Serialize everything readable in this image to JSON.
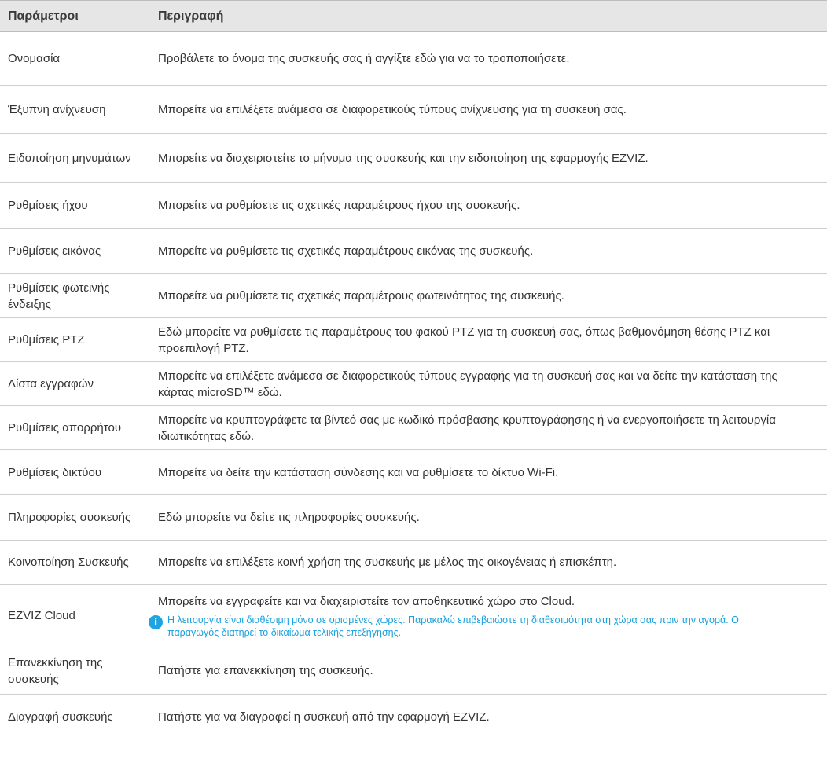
{
  "table": {
    "headers": [
      "Παράμετροι",
      "Περιγραφή"
    ],
    "rows": [
      {
        "param": "Ονομασία",
        "desc": "Προβάλετε το όνομα της συσκευής σας ή αγγίξτε εδώ για να το τροποποιήσετε."
      },
      {
        "param": "Έξυπνη ανίχνευση",
        "desc": "Μπορείτε να επιλέξετε ανάμεσα σε διαφορετικούς τύπους ανίχνευσης για τη συσκευή σας."
      },
      {
        "param": "Ειδοποίηση μηνυμάτων",
        "desc": "Μπορείτε να διαχειριστείτε το μήνυμα της συσκευής και την ειδοποίηση της εφαρμογής EZVIZ."
      },
      {
        "param": "Ρυθμίσεις ήχου",
        "desc": "Μπορείτε να ρυθμίσετε τις σχετικές παραμέτρους ήχου της συσκευής."
      },
      {
        "param": "Ρυθμίσεις εικόνας",
        "desc": "Μπορείτε να ρυθμίσετε τις σχετικές παραμέτρους εικόνας της συσκευής."
      },
      {
        "param": "Ρυθμίσεις φωτεινής ένδειξης",
        "desc": "Μπορείτε να ρυθμίσετε τις σχετικές παραμέτρους φωτεινότητας της συσκευής."
      },
      {
        "param": "Ρυθμίσεις PTZ",
        "desc": "Εδώ μπορείτε να ρυθμίσετε τις παραμέτρους του φακού PTZ για τη συσκευή σας, όπως βαθμονόμηση θέσης PTZ και προεπιλογή PTZ."
      },
      {
        "param": "Λίστα εγγραφών",
        "desc": "Μπορείτε να επιλέξετε ανάμεσα σε διαφορετικούς τύπους εγγραφής για τη συσκευή σας και να δείτε την κατάσταση της κάρτας microSD™ εδώ."
      },
      {
        "param": "Ρυθμίσεις απορρήτου",
        "desc": "Μπορείτε να κρυπτογράφετε τα βίντεό σας με κωδικό πρόσβασης κρυπτογράφησης ή να ενεργοποιήσετε τη λειτουργία ιδιωτικότητας εδώ."
      },
      {
        "param": "Ρυθμίσεις δικτύου",
        "desc": "Μπορείτε να δείτε την κατάσταση σύνδεσης και να ρυθμίσετε το δίκτυο Wi-Fi."
      },
      {
        "param": "Πληροφορίες συσκευής",
        "desc": "Εδώ μπορείτε να δείτε τις πληροφορίες συσκευής."
      },
      {
        "param": "Κοινοποίηση Συσκευής",
        "desc": "Μπορείτε να επιλέξετε κοινή χρήση της συσκευής με μέλος της οικογένειας ή επισκέπτη."
      },
      {
        "param": "EZVIZ Cloud",
        "desc": "Μπορείτε να εγγραφείτε και να διαχειριστείτε τον αποθηκευτικό χώρο στο Cloud.",
        "note": "Η λειτουργία είναι διαθέσιμη μόνο σε ορισμένες χώρες. Παρακαλώ επιβεβαιώστε τη διαθεσιμότητα στη χώρα σας πριν την αγορά. Ο παραγωγός διατηρεί το δικαίωμα τελικής επεξήγησης."
      },
      {
        "param": "Επανεκκίνηση της συσκευής",
        "desc": "Πατήστε για επανεκκίνηση της συσκευής."
      },
      {
        "param": "Διαγραφή συσκευής",
        "desc": "Πατήστε για να διαγραφεί η συσκευή από την εφαρμογή EZVIZ."
      }
    ],
    "note_icon": "info-icon",
    "note_color": "#1fa4e0"
  }
}
